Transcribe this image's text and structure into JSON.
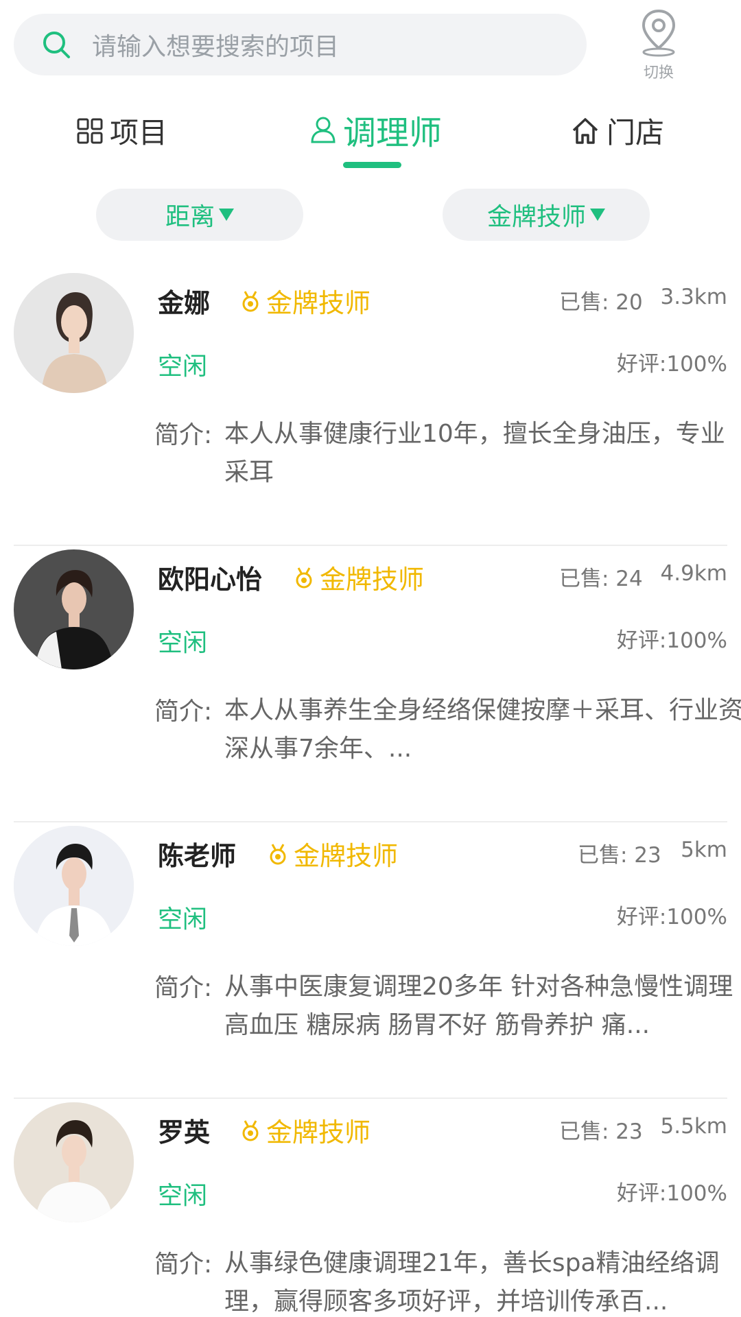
{
  "search": {
    "placeholder": "请输入想要搜索的项目"
  },
  "location_switch": {
    "label": "切换"
  },
  "tabs": [
    {
      "label": "项目"
    },
    {
      "label": "调理师",
      "active": true
    },
    {
      "label": "门店"
    }
  ],
  "filters": [
    {
      "label": "距离"
    },
    {
      "label": "金牌技师"
    }
  ],
  "therapists": [
    {
      "name": "金娜",
      "badge": "金牌技师",
      "sold": "已售: 20",
      "distance": "3.3km",
      "status": "空闲",
      "rating": "好评:100%",
      "intro_label": "简介:",
      "intro": "本人从事健康行业10年，擅长全身油压，专业采耳"
    },
    {
      "name": "欧阳心怡",
      "badge": "金牌技师",
      "sold": "已售: 24",
      "distance": "4.9km",
      "status": "空闲",
      "rating": "好评:100%",
      "intro_label": "简介:",
      "intro": "本人从事养生全身经络保健按摩＋采耳、行业资深从事7余年、..."
    },
    {
      "name": "陈老师",
      "badge": "金牌技师",
      "sold": "已售: 23",
      "distance": "5km",
      "status": "空闲",
      "rating": "好评:100%",
      "intro_label": "简介:",
      "intro": "从事中医康复调理20多年 针对各种急慢性调理 高血压 糖尿病 肠胃不好 筋骨养护 痛..."
    },
    {
      "name": "罗英",
      "badge": "金牌技师",
      "sold": "已售: 23",
      "distance": "5.5km",
      "status": "空闲",
      "rating": "好评:100%",
      "intro_label": "简介:",
      "intro": "从事绿色健康调理21年，善长spa精油经络调理，赢得顾客多项好评，并培训传承百..."
    }
  ],
  "colors": {
    "accent": "#1fbf7f",
    "gold": "#f1b800"
  }
}
